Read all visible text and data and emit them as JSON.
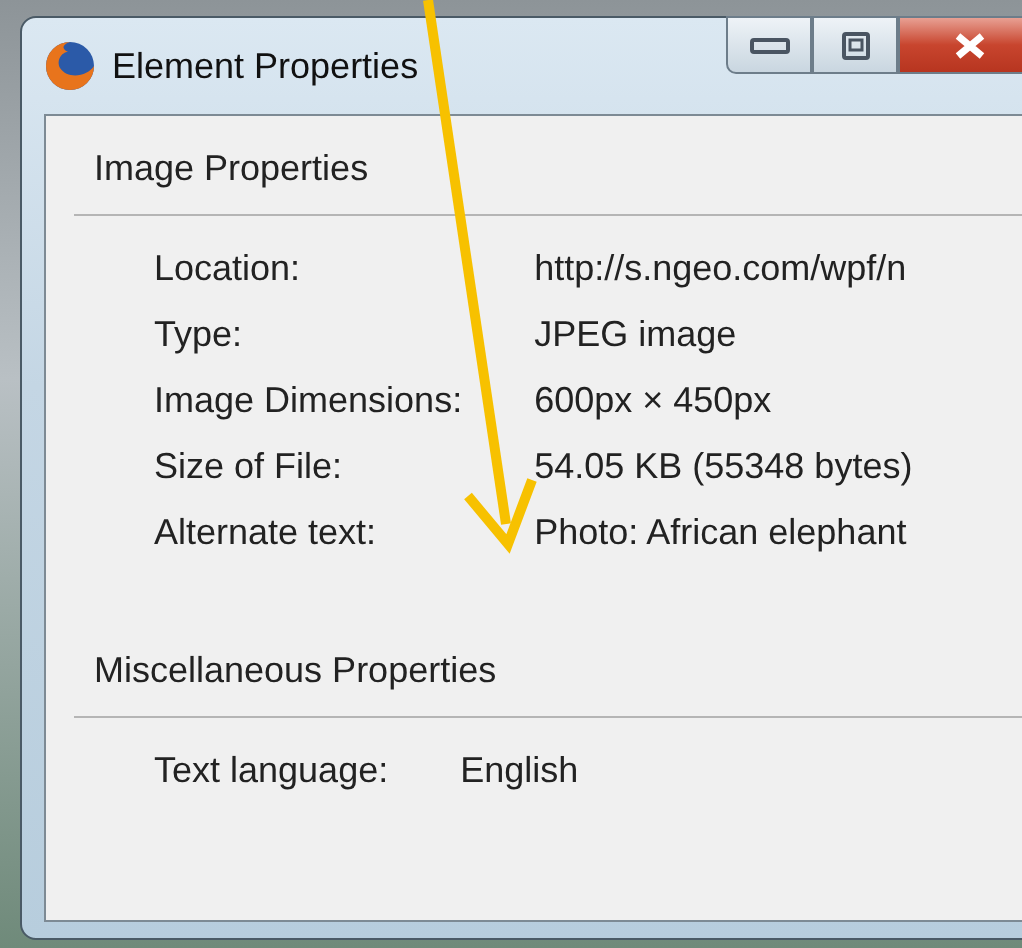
{
  "window": {
    "title": "Element Properties",
    "controls": [
      {
        "kind": "minimize"
      },
      {
        "kind": "maximize"
      },
      {
        "kind": "close"
      }
    ]
  },
  "sections": [
    {
      "title": "Image Properties",
      "rows": [
        {
          "label": "Location:",
          "value": "http://s.ngeo.com/wpf/n"
        },
        {
          "label": "Type:",
          "value": "JPEG image"
        },
        {
          "label": "Image Dimensions:",
          "value": "600px × 450px"
        },
        {
          "label": "Size of File:",
          "value": "54.05 KB (55348 bytes)"
        },
        {
          "label": "Alternate text:",
          "value": "Photo: African elephant"
        }
      ]
    },
    {
      "title": "Miscellaneous Properties",
      "rows": [
        {
          "label": "Text language:",
          "value": "English"
        }
      ]
    }
  ]
}
